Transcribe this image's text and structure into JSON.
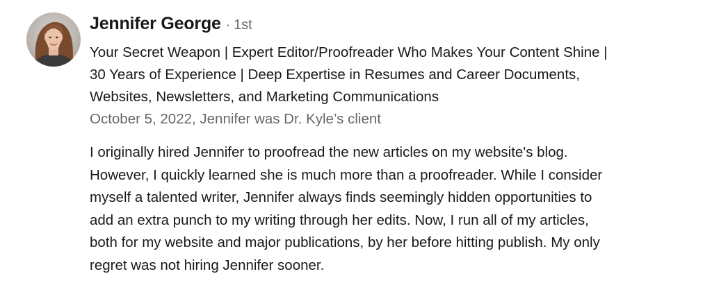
{
  "recommendation": {
    "recommender": {
      "name": "Jennifer George",
      "separator": "·",
      "connection_degree": "1st",
      "headline_lines": [
        "Your Secret Weapon | Expert Editor/Proofreader Who Makes Your Content Shine |",
        "30 Years of Experience | Deep Expertise in Resumes and Career Documents,",
        "Websites, Newsletters, and Marketing Communications"
      ],
      "relationship": "October 5, 2022, Jennifer was Dr. Kyle’s client"
    },
    "text_lines": [
      "I originally hired Jennifer to proofread the new articles on my website's blog.",
      "However, I quickly learned she is much more than a proofreader. While I consider",
      "myself a talented writer, Jennifer always finds seemingly hidden opportunities to",
      "add an extra punch to my writing through her edits. Now, I run all of my articles,",
      "both for my website and major publications, by her before hitting publish. My only",
      "regret was not hiring Jennifer sooner."
    ]
  },
  "colors": {
    "text_primary": "#1f1f1f",
    "text_secondary": "#666666",
    "background": "#ffffff"
  }
}
